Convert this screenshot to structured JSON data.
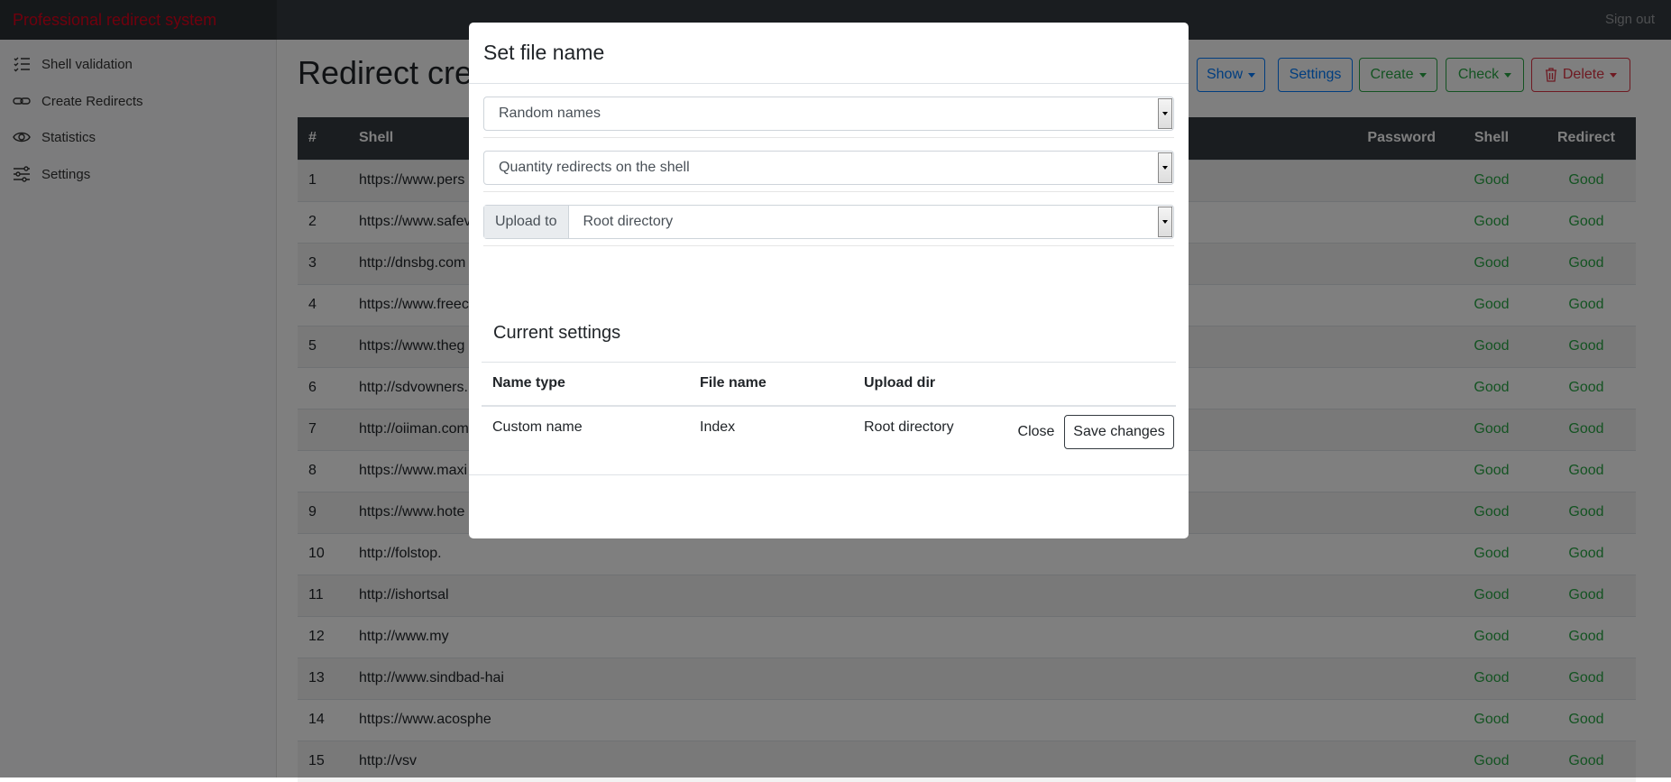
{
  "navbar": {
    "brand": "Professional redirect system",
    "sign_out": "Sign out"
  },
  "sidebar": {
    "items": [
      {
        "label": "Shell validation",
        "icon": "checklist-icon"
      },
      {
        "label": "Create Redirects",
        "icon": "link-icon"
      },
      {
        "label": "Statistics",
        "icon": "eye-icon"
      },
      {
        "label": "Settings",
        "icon": "sliders-icon"
      }
    ]
  },
  "main": {
    "title": "Redirect creat",
    "toolbar": {
      "show": "Show",
      "settings": "Settings",
      "create": "Create",
      "check": "Check",
      "delete": "Delete"
    }
  },
  "colors": {
    "brand": "#e0001a",
    "primary": "#007bff",
    "success": "#28a745",
    "danger": "#dc3545"
  },
  "table": {
    "headers": {
      "num": "#",
      "shell": "Shell",
      "password": "Password",
      "shell_status": "Shell",
      "redirect_status": "Redirect"
    },
    "rows": [
      {
        "n": "1",
        "shell": "https://www.pers",
        "s": "Good",
        "r": "Good"
      },
      {
        "n": "2",
        "shell": "https://www.safev",
        "s": "Good",
        "r": "Good"
      },
      {
        "n": "3",
        "shell": "http://dnsbg.com",
        "s": "Good",
        "r": "Good"
      },
      {
        "n": "4",
        "shell": "https://www.freec",
        "s": "Good",
        "r": "Good"
      },
      {
        "n": "5",
        "shell": "https://www.theg",
        "s": "Good",
        "r": "Good"
      },
      {
        "n": "6",
        "shell": "http://sdvowners.",
        "s": "Good",
        "r": "Good"
      },
      {
        "n": "7",
        "shell": "http://oiiman.com",
        "s": "Good",
        "r": "Good"
      },
      {
        "n": "8",
        "shell": "https://www.maxi",
        "s": "Good",
        "r": "Good"
      },
      {
        "n": "9",
        "shell": "https://www.hote",
        "s": "Good",
        "r": "Good"
      },
      {
        "n": "10",
        "shell": "http://folstop.",
        "s": "Good",
        "r": "Good"
      },
      {
        "n": "11",
        "shell": "http://ishortsal",
        "s": "Good",
        "r": "Good"
      },
      {
        "n": "12",
        "shell": "http://www.my",
        "s": "Good",
        "r": "Good"
      },
      {
        "n": "13",
        "shell": "http://www.sindbad-hai",
        "s": "Good",
        "r": "Good"
      },
      {
        "n": "14",
        "shell": "https://www.acosphe",
        "s": "Good",
        "r": "Good"
      },
      {
        "n": "15",
        "shell": "http://vsv",
        "s": "Good",
        "r": "Good"
      }
    ]
  },
  "modal": {
    "title": "Set file name",
    "name_select": "Random names",
    "quantity_select": "Quantity redirects on the shell",
    "upload_label": "Upload to",
    "upload_select": "Root directory",
    "current_settings": "Current settings",
    "settings_table": {
      "headers": [
        "Name type",
        "File name",
        "Upload dir"
      ],
      "row": [
        "Custom name",
        "Index",
        "Root directory"
      ]
    },
    "close": "Close",
    "save": "Save changes"
  }
}
